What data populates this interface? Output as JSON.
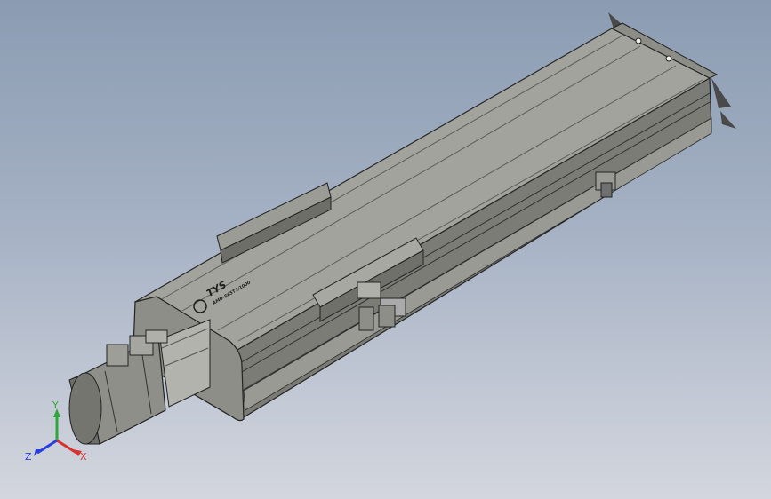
{
  "model": {
    "brand_text": "TYS",
    "model_code_text": "AMD-S65T1/1000"
  },
  "triad": {
    "x_label": "X",
    "y_label": "Y",
    "z_label": "Z",
    "x_color": "#d93030",
    "y_color": "#2fa83a",
    "z_color": "#2b3ed8"
  },
  "colors": {
    "body_top": "#a6a6a0",
    "body_side": "#7a7a74",
    "edge": "#2a2a2a",
    "motor": "#8a8a84"
  }
}
